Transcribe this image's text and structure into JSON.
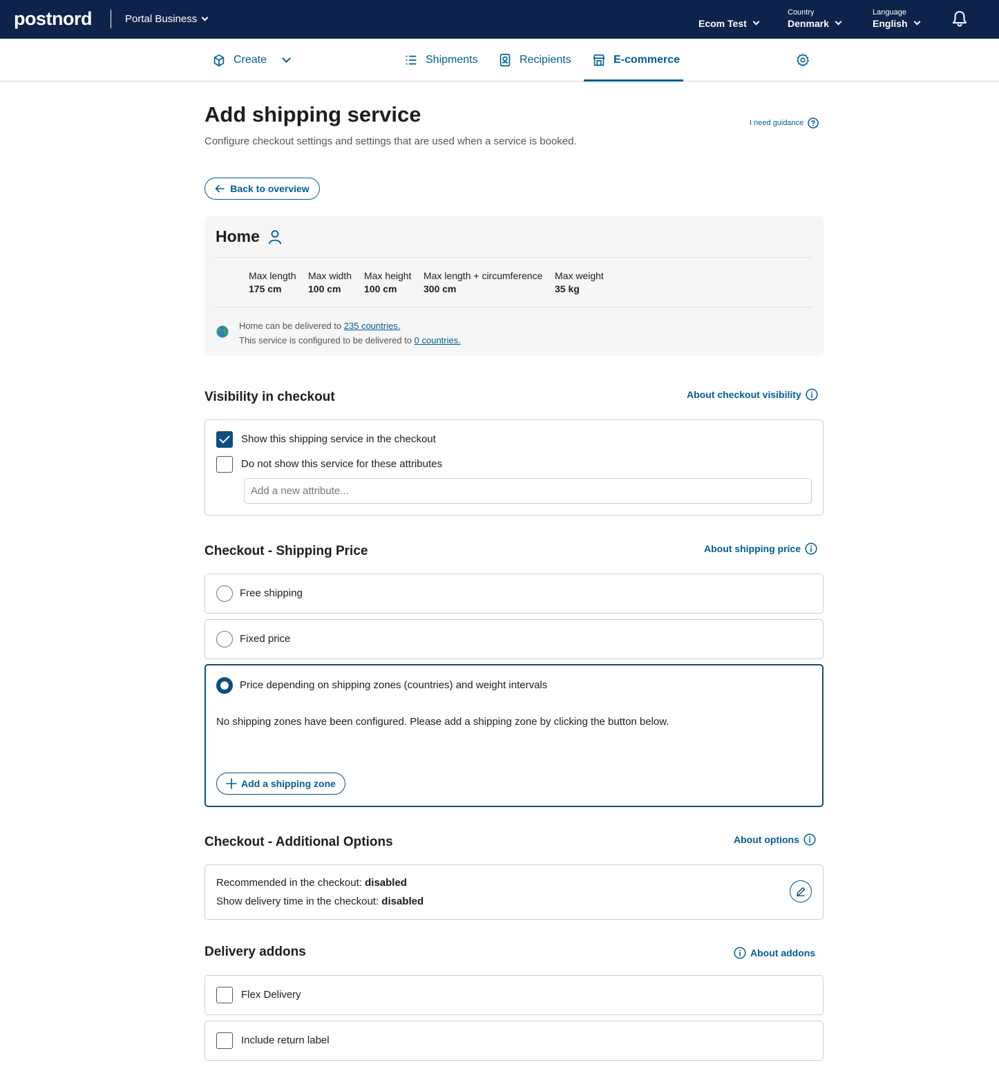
{
  "topbar": {
    "logo": "postnord",
    "portal": "Portal Business",
    "account": "Ecom Test",
    "country_label": "Country",
    "country_value": "Denmark",
    "language_label": "Language",
    "language_value": "English"
  },
  "nav": {
    "create": "Create",
    "shipments": "Shipments",
    "recipients": "Recipients",
    "ecommerce": "E-commerce"
  },
  "page": {
    "title": "Add shipping service",
    "subtitle": "Configure checkout settings and settings that are used when a service is booked.",
    "guidance": "I need guidance",
    "back": "Back to overview"
  },
  "service": {
    "name": "Home",
    "dimensions": [
      {
        "label": "Max length",
        "value": "175 cm"
      },
      {
        "label": "Max width",
        "value": "100 cm"
      },
      {
        "label": "Max height",
        "value": "100 cm"
      },
      {
        "label": "Max length + circumference",
        "value": "300 cm"
      },
      {
        "label": "Max weight",
        "value": "35 kg"
      }
    ],
    "delivered_prefix": "Home can be delivered to ",
    "delivered_link": "235 countries.",
    "configured_prefix": "This service is configured to be delivered to ",
    "configured_link": "0 countries."
  },
  "visibility": {
    "title": "Visibility in checkout",
    "about": "About checkout visibility",
    "show_label": "Show this shipping service in the checkout",
    "show_checked": true,
    "hide_attr_label": "Do not show this service for these attributes",
    "hide_attr_checked": false,
    "attr_placeholder": "Add a new attribute..."
  },
  "price": {
    "title": "Checkout - Shipping Price",
    "about": "About shipping price",
    "free": "Free shipping",
    "fixed": "Fixed price",
    "zones": "Price depending on shipping zones (countries) and weight intervals",
    "selected": "zones",
    "zones_message": "No shipping zones have been configured. Please add a shipping zone by clicking the button below.",
    "add_zone": "Add a shipping zone"
  },
  "options": {
    "title": "Checkout - Additional Options",
    "about": "About options",
    "recommended_label": "Recommended in the checkout: ",
    "recommended_value": "disabled",
    "delivery_time_label": "Show delivery time in the checkout: ",
    "delivery_time_value": "disabled"
  },
  "addons": {
    "title": "Delivery addons",
    "about": "About addons",
    "flex": "Flex Delivery",
    "return_label": "Include return label"
  },
  "colors": {
    "topbar": "#0d234b",
    "accent": "#005d92",
    "selected_border": "#0d4f7c"
  }
}
